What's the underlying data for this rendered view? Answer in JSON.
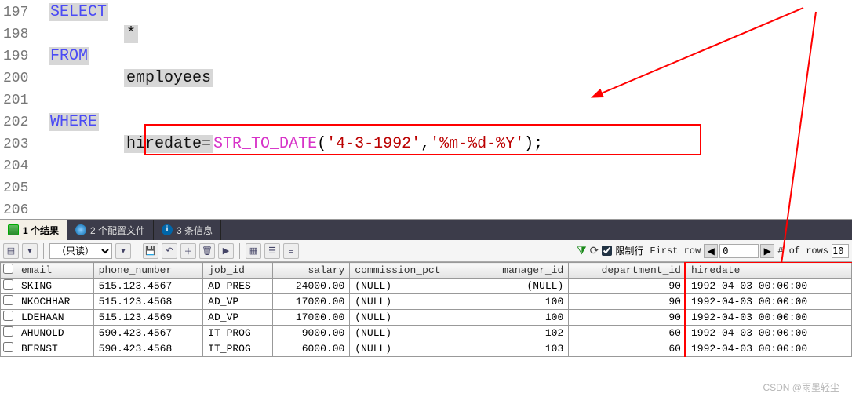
{
  "editor": {
    "lines": [
      {
        "no": "197",
        "tokens": [
          {
            "t": "SELECT",
            "cls": "kw"
          }
        ]
      },
      {
        "no": "198",
        "tokens": [
          {
            "t": "        "
          },
          {
            "t": "*",
            "cls": "sel"
          }
        ]
      },
      {
        "no": "199",
        "tokens": [
          {
            "t": "FROM",
            "cls": "kw"
          }
        ]
      },
      {
        "no": "200",
        "tokens": [
          {
            "t": "        "
          },
          {
            "t": "employees",
            "cls": "sel"
          }
        ]
      },
      {
        "no": "201",
        "tokens": []
      },
      {
        "no": "202",
        "tokens": [
          {
            "t": "WHERE",
            "cls": "kw"
          }
        ]
      },
      {
        "no": "203",
        "tokens": [
          {
            "t": "        "
          },
          {
            "t": "hiredate=",
            "cls": "sel"
          },
          {
            "t": "STR_TO_DATE",
            "cls": "fn"
          },
          {
            "t": "("
          },
          {
            "t": "'4-3-1992'",
            "cls": "str"
          },
          {
            "t": ","
          },
          {
            "t": "'%m-%d-%Y'",
            "cls": "str"
          },
          {
            "t": ");",
            "cls": ""
          }
        ]
      },
      {
        "no": "204",
        "tokens": []
      },
      {
        "no": "205",
        "tokens": []
      },
      {
        "no": "206",
        "tokens": []
      }
    ]
  },
  "tabs": {
    "results": {
      "label": "1 个结果",
      "count": "1"
    },
    "profiles": {
      "label": "2 个配置文件",
      "count": "2"
    },
    "messages": {
      "label": "3 条信息",
      "count": "3"
    }
  },
  "toolbar": {
    "mode_label": "（只读）",
    "limit_label": "限制行",
    "first_row_label": "First row",
    "first_row_value": "0",
    "nrows_label": "# of rows",
    "nrows_value": "10"
  },
  "grid": {
    "columns": [
      "email",
      "phone_number",
      "job_id",
      "salary",
      "commission_pct",
      "manager_id",
      "department_id",
      "hiredate"
    ],
    "rows": [
      {
        "email": "SKING",
        "phone_number": "515.123.4567",
        "job_id": "AD_PRES",
        "salary": "24000.00",
        "commission_pct": "(NULL)",
        "manager_id": "(NULL)",
        "department_id": "90",
        "hiredate": "1992-04-03 00:00:00"
      },
      {
        "email": "NKOCHHAR",
        "phone_number": "515.123.4568",
        "job_id": "AD_VP",
        "salary": "17000.00",
        "commission_pct": "(NULL)",
        "manager_id": "100",
        "department_id": "90",
        "hiredate": "1992-04-03 00:00:00"
      },
      {
        "email": "LDEHAAN",
        "phone_number": "515.123.4569",
        "job_id": "AD_VP",
        "salary": "17000.00",
        "commission_pct": "(NULL)",
        "manager_id": "100",
        "department_id": "90",
        "hiredate": "1992-04-03 00:00:00"
      },
      {
        "email": "AHUNOLD",
        "phone_number": "590.423.4567",
        "job_id": "IT_PROG",
        "salary": "9000.00",
        "commission_pct": "(NULL)",
        "manager_id": "102",
        "department_id": "60",
        "hiredate": "1992-04-03 00:00:00"
      },
      {
        "email": "BERNST",
        "phone_number": "590.423.4568",
        "job_id": "IT_PROG",
        "salary": "6000.00",
        "commission_pct": "(NULL)",
        "manager_id": "103",
        "department_id": "60",
        "hiredate": "1992-04-03 00:00:00"
      }
    ],
    "numeric_cols": [
      "salary",
      "manager_id",
      "department_id"
    ]
  },
  "watermark": "CSDN @雨墨轻尘"
}
